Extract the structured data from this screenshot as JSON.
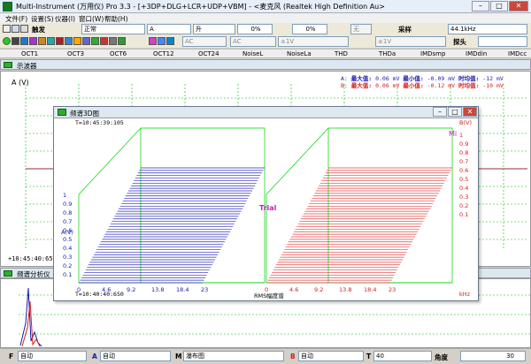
{
  "window": {
    "title": "Multi-Instrument (万用仪) Pro 3.3  -  [+3DP+DLG+LCR+UDP+VBM]  -  <麦克风 (Realtek High Definition Au>"
  },
  "menu": [
    "文件(F)",
    "设置(S)",
    "仪器(I)",
    "窗口(W)",
    "帮助(H)"
  ],
  "toolbar1": {
    "trigger_label": "触发",
    "trigger_mode": "正常",
    "channel": "A",
    "edge": "升",
    "level1": "0%",
    "level2": "0%",
    "coupling": "无",
    "sample_label": "采样",
    "sample_rate": "44.1kHz"
  },
  "toolbar2": {
    "coupling_a": "AC",
    "range_a": "±1V",
    "coupling_b": "AC",
    "range_b": "±1V",
    "probe_label": "探头"
  },
  "tabs": [
    "OCT1",
    "OCT3",
    "OCT6",
    "OCT12",
    "OCT24",
    "NoiseL",
    "NoiseLa",
    "THD",
    "THDa",
    "IMDsmp",
    "IMDdin",
    "IMDcc"
  ],
  "scope": {
    "title": "示波器",
    "yaxis": "A (V)",
    "time": "+10:45:40:650",
    "rowA": {
      "ch": "A:",
      "max_l": "最大值:",
      "max_v": "0.06 mV",
      "min_l": "最小值:",
      "min_v": "-0.09 mV",
      "rms_l": "时均值:",
      "rms_v": "-12 mV"
    },
    "rowB": {
      "ch": "B:",
      "max_l": "最大值:",
      "max_v": "0.06 mV",
      "min_l": "最小值:",
      "min_v": "-0.12 mV",
      "rms_l": "时均值:",
      "rms_v": "-10 mV"
    }
  },
  "spec3d": {
    "title": "频谱3D图",
    "time_top": "T=10:45:39:105",
    "time_bottom": "T=10:40:40:650",
    "yaxis_a": "A(V)",
    "yaxis_b": "B(V)",
    "yticks": [
      "1",
      "0.9",
      "0.8",
      "0.7",
      "0.6",
      "0.5",
      "0.4",
      "0.3",
      "0.2",
      "0.1"
    ],
    "xticks": [
      "0",
      "4.6",
      "9.2",
      "13.8",
      "18.4",
      "23"
    ],
    "xunit": "kHz",
    "rms_label": "RMS幅度谱",
    "watermark": "Trial",
    "ch_b_label": "Mi"
  },
  "spectrum": {
    "title": "频谱分析仪"
  },
  "bottom": {
    "f_label": "F",
    "f_val": "自动",
    "a_label": "A",
    "a_val": "自动",
    "m_label": "M",
    "m_val": "瀑布图",
    "b_label": "B",
    "b_val": "自动",
    "t_label": "T",
    "t_val": "40",
    "angle_label": "角度",
    "angle_val": "30"
  },
  "colors": {
    "channel_a": "#1a1ab0",
    "channel_b": "#d22020",
    "grid": "#00d000"
  }
}
